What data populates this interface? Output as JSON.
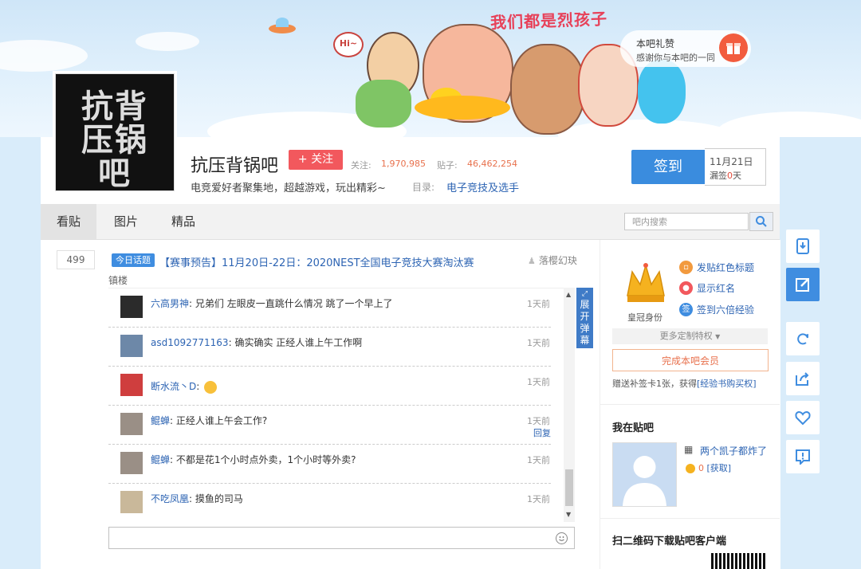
{
  "banner": {
    "slogan": "我们都是烈孩子",
    "hi_text": "Hi~",
    "gift_title": "本吧礼赞",
    "gift_subtitle": "感谢你与本吧的一同"
  },
  "header": {
    "bar_name": "抗压背锅吧",
    "logo_text": "抗压背锅吧",
    "follow_label": "+ 关注",
    "follow_count_label": "关注:",
    "follow_count": "1,970,985",
    "posts_label": "贴子:",
    "posts_count": "46,462,254",
    "slogan": "电竞爱好者聚集地，超越游戏，玩出精彩~",
    "dir_label": "目录:",
    "dir_link": "电子竞技及选手",
    "sign_label": "签到",
    "sign_date": "11月21日",
    "sign_missed_prefix": "漏签",
    "sign_missed_count": "0",
    "sign_missed_suffix": "天"
  },
  "tabs": [
    {
      "label": "看贴",
      "active": true
    },
    {
      "label": "图片",
      "active": false
    },
    {
      "label": "精品",
      "active": false
    }
  ],
  "search": {
    "placeholder": "吧内搜索"
  },
  "topic": {
    "reply_count": "499",
    "badge": "今日话题",
    "title": "【赛事预告】11月20日-22日：2020NEST全国电子竞技大赛淘汰赛",
    "author": "落樱幻玦",
    "floor_label": "镇楼"
  },
  "danmu": {
    "expand_label": "展开弹幕",
    "items": [
      {
        "name": "六高男神",
        "text": "兄弟们 左眼皮一直跳什么情况 跳了一个早上了",
        "time": "1天前",
        "reply": ""
      },
      {
        "name": "asd1092771163",
        "text": "确实确实 正经人谁上午工作啊",
        "time": "1天前",
        "reply": ""
      },
      {
        "name": "断水流丶D",
        "text": "",
        "time": "1天前",
        "reply": ""
      },
      {
        "name": "鲲蝉",
        "text": "正经人谁上午会工作?",
        "time": "1天前",
        "reply": "回复"
      },
      {
        "name": "鲲蝉",
        "text": "不都是花1个小时点外卖，1个小时等外卖?",
        "time": "1天前",
        "reply": ""
      },
      {
        "name": "不吃凤凰",
        "text": "摸鱼的司马",
        "time": "1天前",
        "reply": ""
      }
    ]
  },
  "sidebar": {
    "crown_label": "皇冠身份",
    "perks": [
      "发贴红色标题",
      "显示红名",
      "签到六倍经验"
    ],
    "more_perks": "更多定制特权",
    "member_button": "完成本吧会员",
    "bonus_text": "赠送补签卡1张，获得",
    "bonus_link": "[经验书购买权]",
    "my_section": "我在贴吧",
    "profile_name": "两个凯子都炸了",
    "coin_count": "0",
    "coin_link": "[获取]",
    "qr_title": "扫二维码下载贴吧客户端"
  },
  "colors": {
    "accent": "#3f8de0",
    "follow_red": "#f2585d",
    "count_orange": "#e8714d",
    "link_blue": "#2d64b3"
  }
}
